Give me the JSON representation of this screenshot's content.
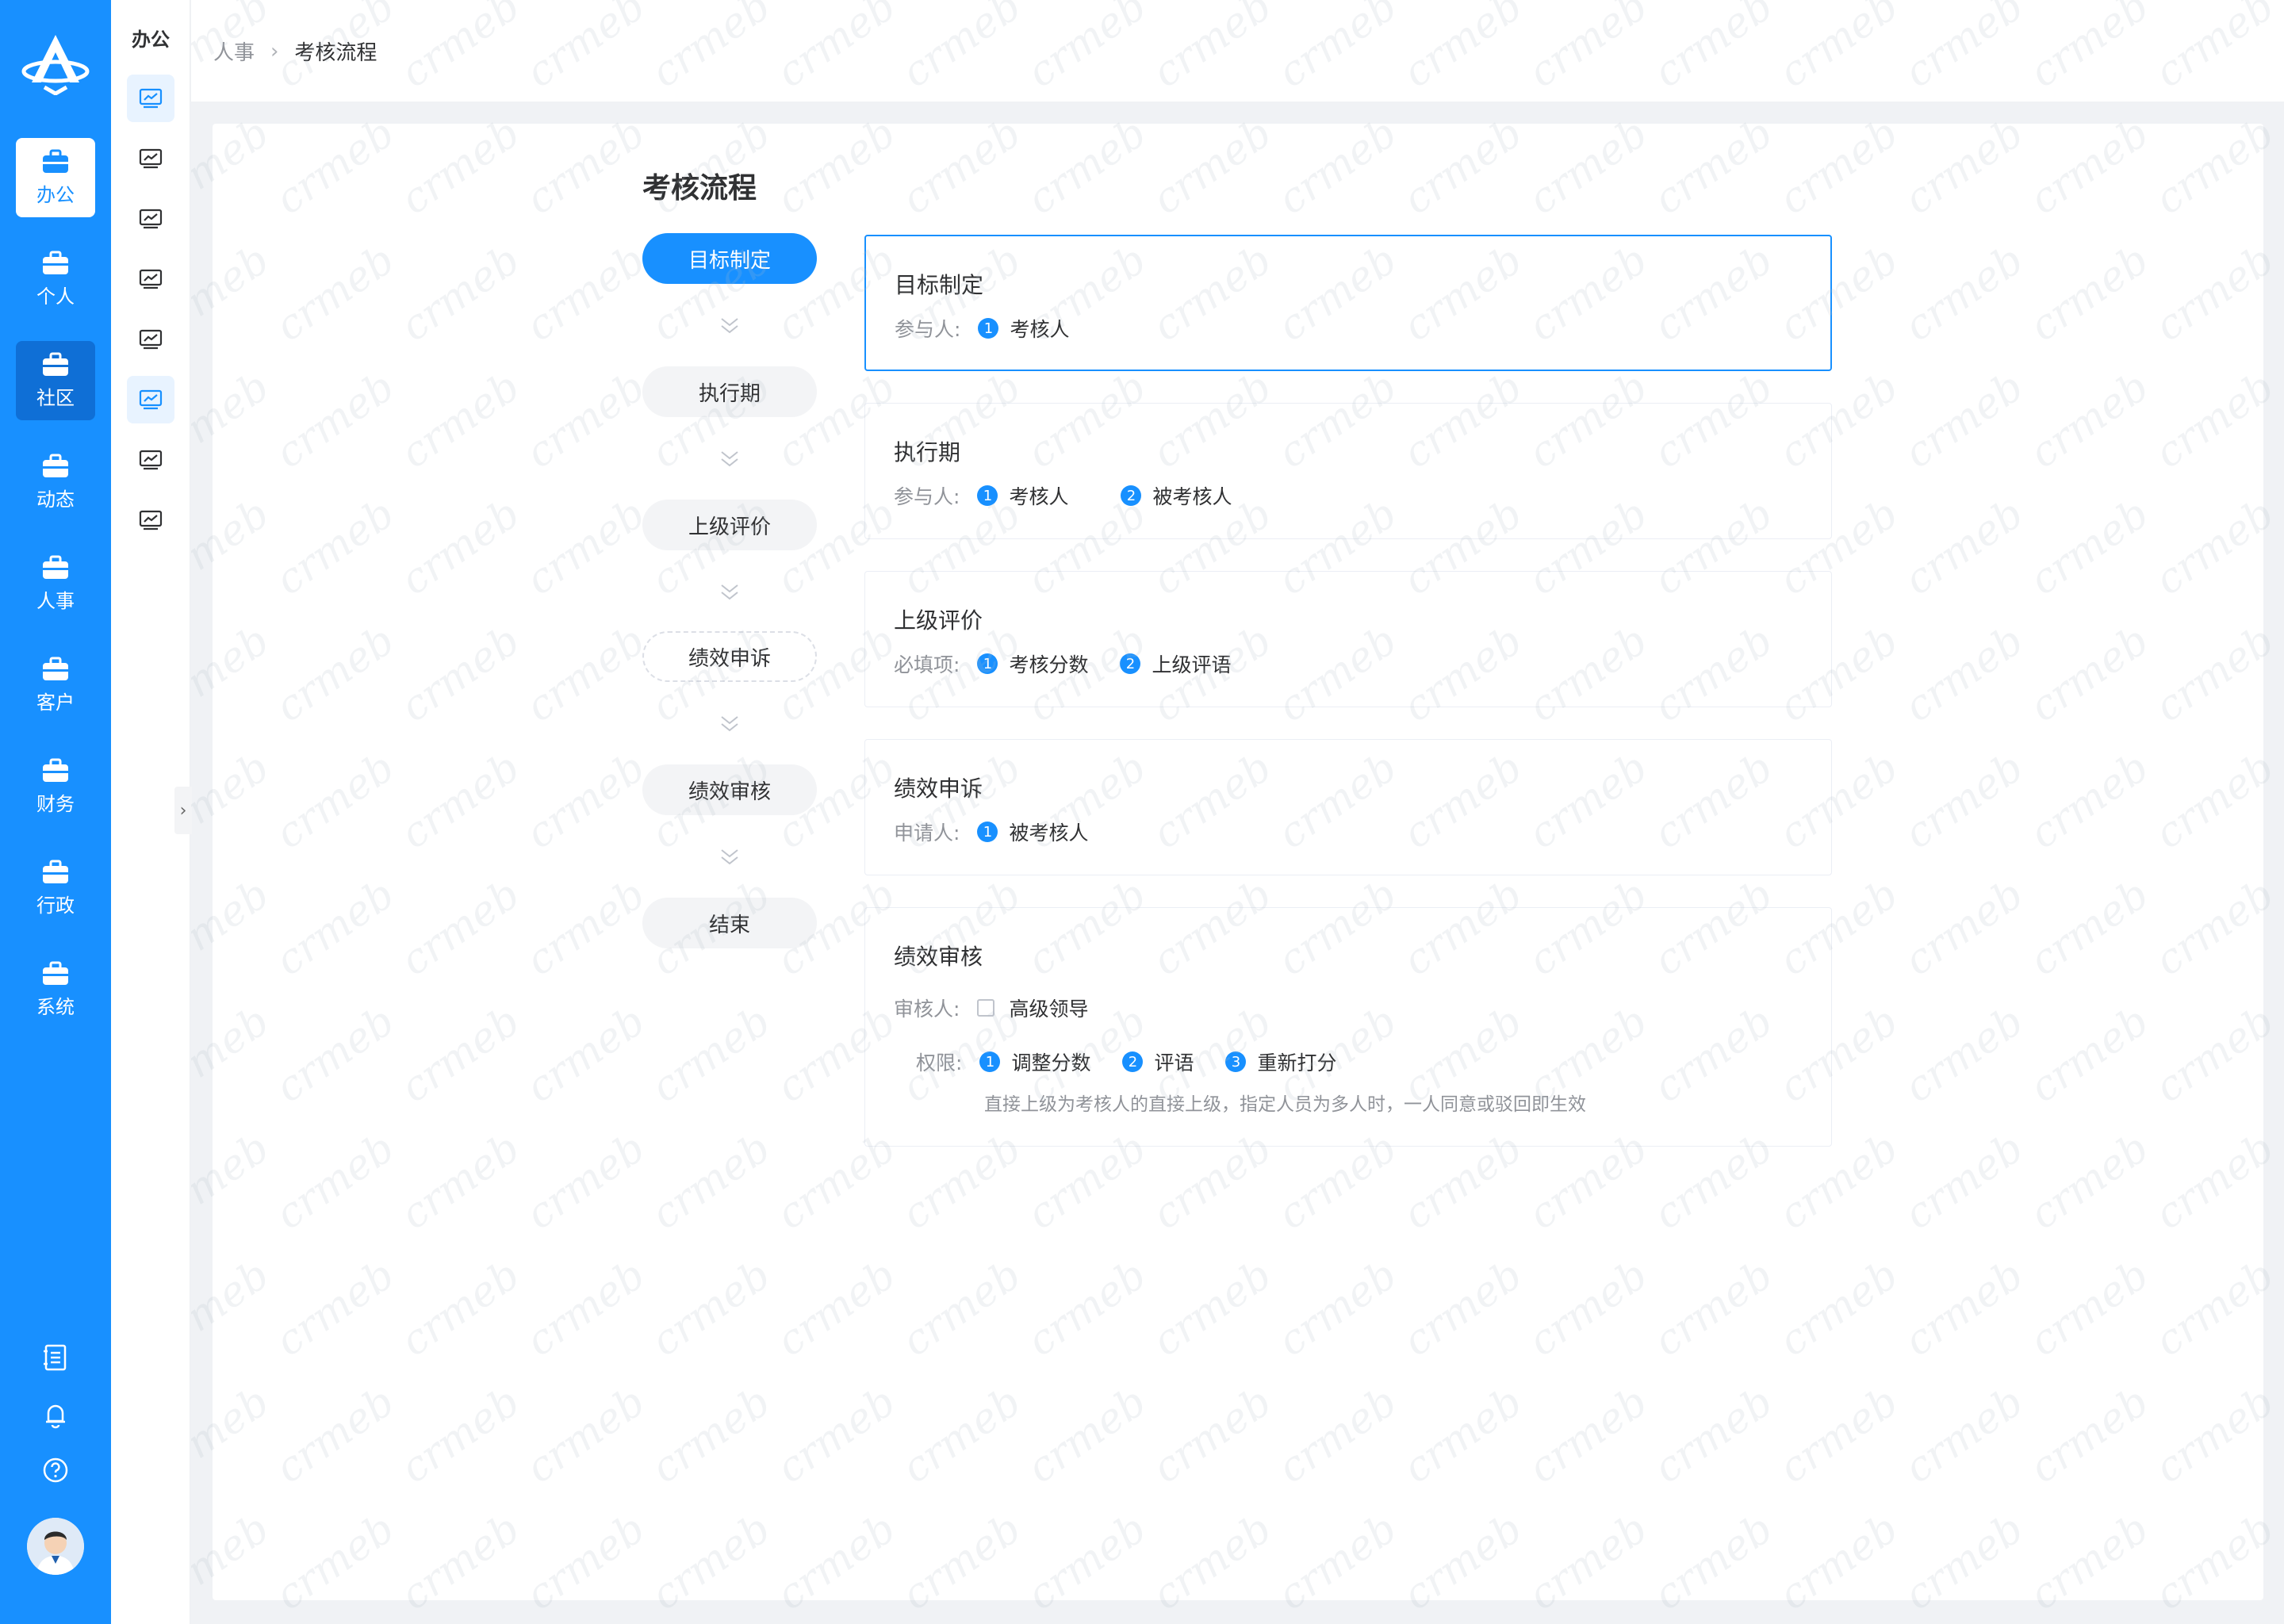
{
  "rail": {
    "items": [
      {
        "label": "办公",
        "active": true
      },
      {
        "label": "个人"
      },
      {
        "label": "社区",
        "hover": true
      },
      {
        "label": "动态"
      },
      {
        "label": "人事"
      },
      {
        "label": "客户"
      },
      {
        "label": "财务"
      },
      {
        "label": "行政"
      },
      {
        "label": "系统"
      }
    ],
    "bottom_icons": [
      "notebook-icon",
      "bell-icon",
      "help-icon"
    ]
  },
  "subnav": {
    "title": "办公",
    "active_index": 0,
    "hover_index": 5,
    "item_count": 8
  },
  "breadcrumb": {
    "parent": "人事",
    "current": "考核流程"
  },
  "page": {
    "title": "考核流程"
  },
  "steps": [
    {
      "label": "目标制定",
      "state": "active"
    },
    {
      "label": "执行期",
      "state": "normal"
    },
    {
      "label": "上级评价",
      "state": "normal"
    },
    {
      "label": "绩效申诉",
      "state": "dashed"
    },
    {
      "label": "绩效审核",
      "state": "normal"
    },
    {
      "label": "结束",
      "state": "normal"
    }
  ],
  "cards": [
    {
      "title": "目标制定",
      "label": "参与人:",
      "items": [
        {
          "n": "1",
          "text": "考核人"
        }
      ]
    },
    {
      "title": "执行期",
      "label": "参与人:",
      "items": [
        {
          "n": "1",
          "text": "考核人"
        },
        {
          "n": "2",
          "text": "被考核人"
        }
      ]
    },
    {
      "title": "上级评价",
      "label": "必填项:",
      "items": [
        {
          "n": "1",
          "text": "考核分数"
        },
        {
          "n": "2",
          "text": "上级评语"
        }
      ]
    },
    {
      "title": "绩效申诉",
      "label": "申请人:",
      "items": [
        {
          "n": "1",
          "text": "被考核人"
        }
      ]
    },
    {
      "title": "绩效审核",
      "reviewer_label": "审核人:",
      "reviewer_option": "高级领导",
      "perm_label": "权限:",
      "items": [
        {
          "n": "1",
          "text": "调整分数"
        },
        {
          "n": "2",
          "text": "评语"
        },
        {
          "n": "3",
          "text": "重新打分"
        }
      ],
      "note": "直接上级为考核人的直接上级，指定人员为多人时，一人同意或驳回即生效"
    }
  ],
  "colors": {
    "primary": "#1890ff",
    "background": "#f0f2f5"
  }
}
